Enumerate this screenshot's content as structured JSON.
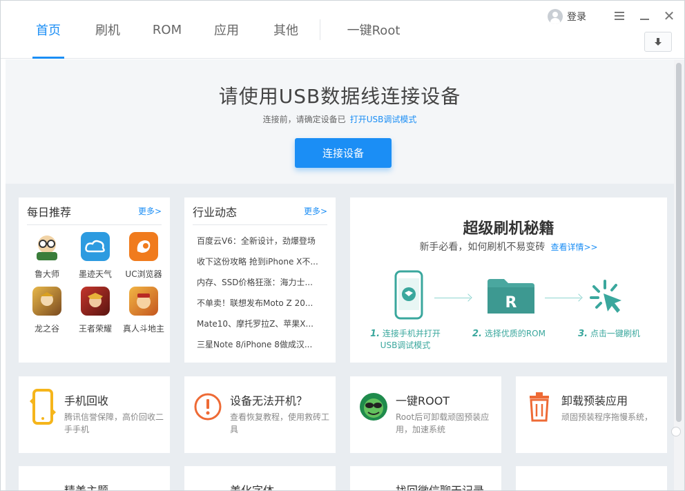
{
  "nav": {
    "items": [
      {
        "label": "首页",
        "active": true
      },
      {
        "label": "刷机"
      },
      {
        "label": "ROM"
      },
      {
        "label": "应用"
      },
      {
        "label": "其他"
      }
    ],
    "root_label": "一键Root"
  },
  "header": {
    "login_label": "登录"
  },
  "hero": {
    "title": "请使用USB数据线连接设备",
    "subtitle": "连接前，请确定设备已",
    "subtitle_link": "打开USB调试模式",
    "button": "连接设备"
  },
  "daily": {
    "title": "每日推荐",
    "more": "更多>",
    "apps": [
      {
        "label": "鲁大师",
        "icon": "ludashi-icon",
        "color": "#3a7d3a"
      },
      {
        "label": "墨迹天气",
        "icon": "moji-weather-icon",
        "color": "#2d9be0"
      },
      {
        "label": "UC浏览器",
        "icon": "uc-browser-icon",
        "color": "#f07b1d"
      },
      {
        "label": "龙之谷",
        "icon": "dragon-nest-icon",
        "color": "#c98a2a"
      },
      {
        "label": "王者荣耀",
        "icon": "honor-of-kings-icon",
        "color": "#b5342b"
      },
      {
        "label": "真人斗地主",
        "icon": "doudizhu-icon",
        "color": "#d9862c"
      }
    ]
  },
  "news": {
    "title": "行业动态",
    "more": "更多>",
    "items": [
      "百度云V6：全新设计，劲爆登场",
      "收下这份攻略 抢到iPhone X不...",
      "内存、SSD价格狂涨：海力士...",
      "不单卖！联想发布Moto Z 20...",
      "Mate10、摩托罗拉Z、苹果X...",
      "三星Note 8/iPhone 8做成汉..."
    ]
  },
  "guide": {
    "title": "超级刷机秘籍",
    "subtitle": "新手必看，如何刷机不易变砖",
    "link": "查看详情>>",
    "steps": [
      {
        "num": "1.",
        "text": "连接手机并打开",
        "text2": "USB调试模式"
      },
      {
        "num": "2.",
        "text": "选择优质的ROM",
        "text2": ""
      },
      {
        "num": "3.",
        "text": "点击一键刷机",
        "text2": ""
      }
    ],
    "rom_letter": "R",
    "accent": "#3aa79d"
  },
  "features": [
    {
      "title": "手机回收",
      "desc": "腾讯信誉保障，高价回收二手手机",
      "icon": "phone-recycle-icon"
    },
    {
      "title": "设备无法开机？",
      "desc": "查看恢复教程，使用救砖工具",
      "icon": "warning-icon"
    },
    {
      "title": "一键ROOT",
      "desc": "Root后可卸载顽固预装应用，加速系统",
      "icon": "root-mascot-icon"
    },
    {
      "title": "卸载预装应用",
      "desc": "顽固预装程序拖慢系统，",
      "icon": "trash-icon"
    }
  ],
  "bottom": [
    {
      "title": "精美主题"
    },
    {
      "title": "美化字体"
    },
    {
      "title": "找回微信聊天记录"
    },
    {
      "title": ""
    }
  ]
}
